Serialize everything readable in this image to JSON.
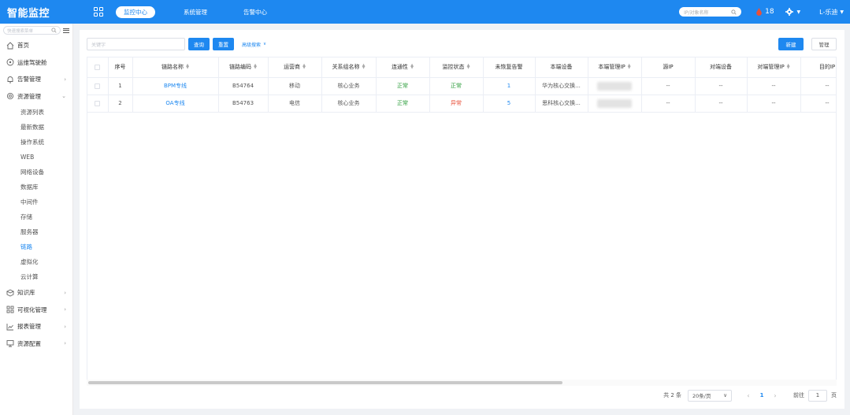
{
  "app": {
    "brand": "智能监控"
  },
  "topnav": {
    "items": [
      {
        "label": "监控中心",
        "active": true
      },
      {
        "label": "系统管理",
        "active": false
      },
      {
        "label": "告警中心",
        "active": false
      }
    ],
    "search_placeholder": "IP/对象名称",
    "alarm_count": "18",
    "user": "L-乐迪"
  },
  "sidebar": {
    "search_placeholder": "快速搜索菜单",
    "menu": [
      {
        "label": "首页",
        "icon": "home-icon"
      },
      {
        "label": "运维驾驶舱",
        "icon": "dashboard-icon"
      },
      {
        "label": "告警管理",
        "icon": "bell-icon"
      },
      {
        "label": "资源管理",
        "icon": "resource-icon"
      },
      {
        "label": "知识库",
        "icon": "knowledge-icon"
      },
      {
        "label": "可视化管理",
        "icon": "grid-icon"
      },
      {
        "label": "报表管理",
        "icon": "chart-icon"
      },
      {
        "label": "资源配置",
        "icon": "monitor-icon"
      }
    ],
    "sub_items": [
      "资源列表",
      "最新数据",
      "操作系统",
      "WEB",
      "网络设备",
      "数据库",
      "中间件",
      "存储",
      "服务器",
      "链路",
      "虚拟化",
      "云计算"
    ],
    "active_sub": "链路"
  },
  "toolbar": {
    "keyword_placeholder": "关键字",
    "query_label": "查询",
    "reset_label": "重置",
    "advanced_label": "高级搜索",
    "new_label": "新建",
    "manage_label": "管理"
  },
  "table": {
    "columns": [
      "序号",
      "链路名称",
      "链路编码",
      "运营商",
      "关系组名称",
      "连通性",
      "监控状态",
      "未恢复告警",
      "本端设备",
      "本端管理IP",
      "源IP",
      "对端设备",
      "对端管理IP",
      "目的IP"
    ],
    "rows": [
      {
        "index": "1",
        "name": "BPM专线",
        "code": "B54764",
        "carrier": "移动",
        "group": "核心业务",
        "connectivity": "正常",
        "status": "正常",
        "alarms": "1",
        "local_device": "华为核心交换...",
        "src_ip": "--",
        "peer_device": "--",
        "peer_ip": "--",
        "dst_ip": "--"
      },
      {
        "index": "2",
        "name": "OA专线",
        "code": "B54763",
        "carrier": "电信",
        "group": "核心业务",
        "connectivity": "正常",
        "status": "异常",
        "alarms": "5",
        "local_device": "思科核心交换...",
        "src_ip": "--",
        "peer_device": "--",
        "peer_ip": "--",
        "dst_ip": "--"
      }
    ]
  },
  "pagination": {
    "total": "共 2 条",
    "page_size": "20条/页",
    "current": "1",
    "goto_label": "前往",
    "goto_value": "1",
    "page_unit": "页"
  },
  "colors": {
    "primary": "#1e88f0",
    "ok": "#2e9e3c",
    "error": "#e8503a"
  }
}
